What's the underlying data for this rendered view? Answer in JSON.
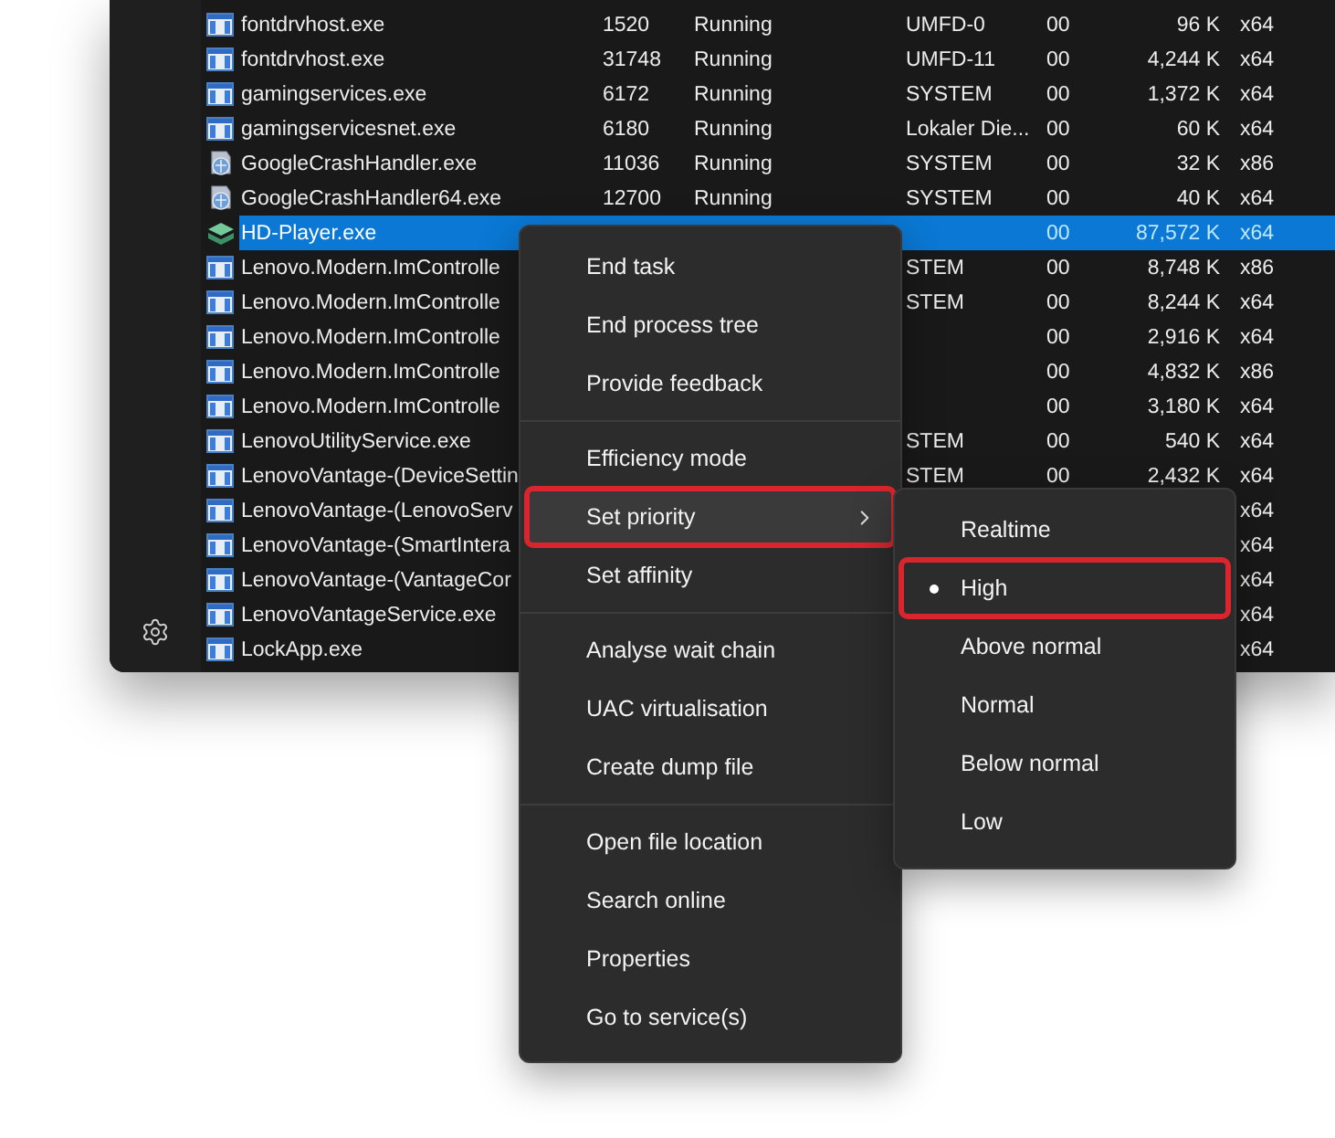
{
  "processes": [
    {
      "kind": "window",
      "name": "fontdrvhost.exe",
      "pid": "1520",
      "status": "Running",
      "user": "UMFD-0",
      "cpu": "00",
      "memory": "96 K",
      "arch": "x64",
      "selected": false
    },
    {
      "kind": "window",
      "name": "fontdrvhost.exe",
      "pid": "31748",
      "status": "Running",
      "user": "UMFD-11",
      "cpu": "00",
      "memory": "4,244 K",
      "arch": "x64",
      "selected": false
    },
    {
      "kind": "window",
      "name": "gamingservices.exe",
      "pid": "6172",
      "status": "Running",
      "user": "SYSTEM",
      "cpu": "00",
      "memory": "1,372 K",
      "arch": "x64",
      "selected": false
    },
    {
      "kind": "window",
      "name": "gamingservicesnet.exe",
      "pid": "6180",
      "status": "Running",
      "user": "Lokaler Die...",
      "cpu": "00",
      "memory": "60 K",
      "arch": "x64",
      "selected": false
    },
    {
      "kind": "installer",
      "name": "GoogleCrashHandler.exe",
      "pid": "11036",
      "status": "Running",
      "user": "SYSTEM",
      "cpu": "00",
      "memory": "32 K",
      "arch": "x86",
      "selected": false
    },
    {
      "kind": "installer",
      "name": "GoogleCrashHandler64.exe",
      "pid": "12700",
      "status": "Running",
      "user": "SYSTEM",
      "cpu": "00",
      "memory": "40 K",
      "arch": "x64",
      "selected": false
    },
    {
      "kind": "layers",
      "name": "HD-Player.exe",
      "cpu": "00",
      "memory": "87,572 K",
      "arch": "x64",
      "selected": true
    },
    {
      "kind": "window",
      "name": "Lenovo.Modern.ImControlle",
      "user": "STEM",
      "cpu": "00",
      "memory": "8,748 K",
      "arch": "x86",
      "selected": false
    },
    {
      "kind": "window",
      "name": "Lenovo.Modern.ImControlle",
      "user": "STEM",
      "cpu": "00",
      "memory": "8,244 K",
      "arch": "x64",
      "selected": false
    },
    {
      "kind": "window",
      "name": "Lenovo.Modern.ImControlle",
      "cpu": "00",
      "memory": "2,916 K",
      "arch": "x64",
      "selected": false
    },
    {
      "kind": "window",
      "name": "Lenovo.Modern.ImControlle",
      "cpu": "00",
      "memory": "4,832 K",
      "arch": "x86",
      "selected": false
    },
    {
      "kind": "window",
      "name": "Lenovo.Modern.ImControlle",
      "cpu": "00",
      "memory": "3,180 K",
      "arch": "x64",
      "selected": false
    },
    {
      "kind": "window",
      "name": "LenovoUtilityService.exe",
      "user": "STEM",
      "cpu": "00",
      "memory": "540 K",
      "arch": "x64",
      "selected": false
    },
    {
      "kind": "window",
      "name": "LenovoVantage-(DeviceSettin",
      "user": "STEM",
      "cpu": "00",
      "memory": "2,432 K",
      "arch": "x64",
      "selected": false
    },
    {
      "kind": "window",
      "name": "LenovoVantage-(LenovoServ",
      "arch": "x64",
      "selected": false
    },
    {
      "kind": "window",
      "name": "LenovoVantage-(SmartIntera",
      "arch": "x64",
      "selected": false
    },
    {
      "kind": "window",
      "name": "LenovoVantage-(VantageCor",
      "arch": "x64",
      "selected": false
    },
    {
      "kind": "window",
      "name": "LenovoVantageService.exe",
      "arch": "x64",
      "selected": false
    },
    {
      "kind": "window",
      "name": "LockApp.exe",
      "arch": "x64",
      "selected": false
    }
  ],
  "context_menu": {
    "groups": [
      [
        {
          "label": "End task",
          "selected": false,
          "highlighted": false,
          "submenu": false
        },
        {
          "label": "End process tree",
          "selected": false,
          "highlighted": false,
          "submenu": false
        },
        {
          "label": "Provide feedback",
          "selected": false,
          "highlighted": false,
          "submenu": false
        }
      ],
      [
        {
          "label": "Efficiency mode",
          "selected": false,
          "highlighted": false,
          "submenu": false
        },
        {
          "label": "Set priority",
          "selected": true,
          "highlighted": true,
          "submenu": true
        },
        {
          "label": "Set affinity",
          "selected": false,
          "highlighted": false,
          "submenu": false
        }
      ],
      [
        {
          "label": "Analyse wait chain",
          "selected": false,
          "highlighted": false,
          "submenu": false
        },
        {
          "label": "UAC virtualisation",
          "selected": false,
          "highlighted": false,
          "submenu": false
        },
        {
          "label": "Create dump file",
          "selected": false,
          "highlighted": false,
          "submenu": false
        }
      ],
      [
        {
          "label": "Open file location",
          "selected": false,
          "highlighted": false,
          "submenu": false
        },
        {
          "label": "Search online",
          "selected": false,
          "highlighted": false,
          "submenu": false
        },
        {
          "label": "Properties",
          "selected": false,
          "highlighted": false,
          "submenu": false
        },
        {
          "label": "Go to service(s)",
          "selected": false,
          "highlighted": false,
          "submenu": false
        }
      ]
    ]
  },
  "priority_submenu": [
    {
      "label": "Realtime",
      "selected": false,
      "highlighted": false
    },
    {
      "label": "High",
      "selected": true,
      "highlighted": true
    },
    {
      "label": "Above normal",
      "selected": false,
      "highlighted": false
    },
    {
      "label": "Normal",
      "selected": false,
      "highlighted": false
    },
    {
      "label": "Below normal",
      "selected": false,
      "highlighted": false
    },
    {
      "label": "Low",
      "selected": false,
      "highlighted": false
    }
  ]
}
